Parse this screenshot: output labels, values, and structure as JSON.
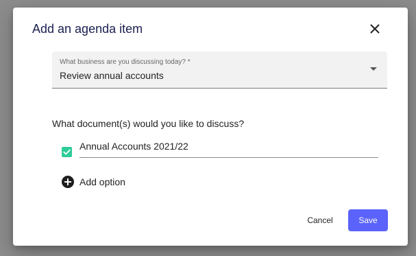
{
  "dialog": {
    "title": "Add an agenda item",
    "close_icon": "close-icon"
  },
  "business_select": {
    "label": "What business are you discussing today? *",
    "value": "Review annual accounts",
    "arrow_icon": "dropdown-arrow-icon"
  },
  "documents": {
    "question": "What document(s) would you like to discuss?",
    "items": [
      {
        "label": "Annual Accounts 2021/22",
        "checked": true
      }
    ],
    "add_option_label": "Add option",
    "add_option_icon": "add-circle-icon"
  },
  "actions": {
    "cancel_label": "Cancel",
    "save_label": "Save"
  },
  "colors": {
    "title": "#1a1f4f",
    "checkbox": "#2ecc9a",
    "primary_button": "#5b63fb",
    "backdrop": "#8c8c8c"
  }
}
